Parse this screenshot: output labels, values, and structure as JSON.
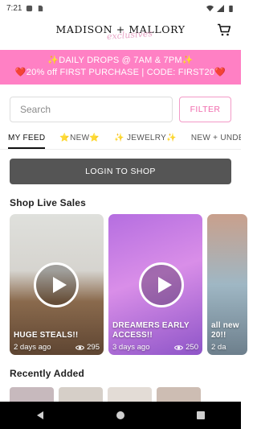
{
  "status_bar": {
    "time": "7:21"
  },
  "header": {
    "logo_main": "MADISON + MALLORY",
    "logo_script": "exclusives"
  },
  "promo": {
    "line1": "✨DAILY DROPS @ 7AM & 7PM✨",
    "line2": "❤️20% off FIRST PURCHASE | CODE: FIRST20❤️"
  },
  "search": {
    "placeholder": "Search",
    "filter_label": "FILTER"
  },
  "tabs": [
    {
      "label": "MY FEED"
    },
    {
      "label": "⭐NEW⭐"
    },
    {
      "label": "✨ JEWELRY✨"
    },
    {
      "label": "NEW + UNDER"
    }
  ],
  "login_label": "LOGIN TO SHOP",
  "live_section": {
    "title": "Shop Live Sales",
    "cards": [
      {
        "title": "HUGE STEALS!!",
        "age": "2 days ago",
        "views": "295"
      },
      {
        "title": "DREAMERS EARLY ACCESS!!",
        "age": "3 days ago",
        "views": "250"
      },
      {
        "title": "all new 20!!",
        "age": "2 da",
        "views": ""
      }
    ]
  },
  "recent_section": {
    "title": "Recently Added"
  },
  "colors": {
    "promo_bg": "#ff80c4",
    "accent_pink": "#f06aad",
    "login_bg": "#555555"
  }
}
